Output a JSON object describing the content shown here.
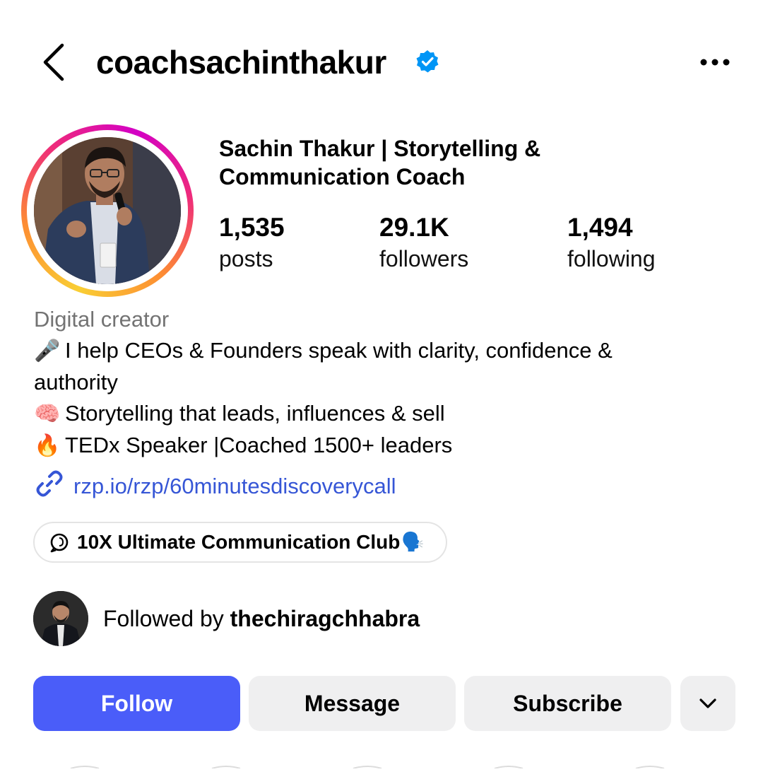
{
  "header": {
    "username": "coachsachinthakur",
    "verified": true,
    "back_icon": "chevron-left-icon",
    "more_icon": "more-horizontal-icon"
  },
  "profile": {
    "display_name": "Sachin Thakur | Storytelling & Communication Coach",
    "stats": [
      {
        "value": "1,535",
        "label": "posts"
      },
      {
        "value": "29.1K",
        "label": "followers"
      },
      {
        "value": "1,494",
        "label": "following"
      }
    ],
    "category": "Digital creator",
    "bio_lines": [
      {
        "emoji": "🎤",
        "text": "I help CEOs & Founders speak with clarity, confidence &"
      },
      {
        "emoji": "",
        "text": "authority"
      },
      {
        "emoji": "🧠",
        "text": "Storytelling that leads, influences & sell"
      },
      {
        "emoji": "🔥",
        "text": "TEDx Speaker |Coached 1500+ leaders"
      }
    ],
    "link": "rzp.io/rzp/60minutesdiscoverycall",
    "thread_chip": "10X Ultimate Communication Club",
    "thread_chip_emoji": "🗣️",
    "followed_by_prefix": "Followed by ",
    "followed_by_user": "thechiragchhabra"
  },
  "actions": {
    "follow": "Follow",
    "message": "Message",
    "subscribe": "Subscribe",
    "more_icon": "chevron-down-icon"
  },
  "colors": {
    "follow_button": "#4a5df9",
    "secondary_button": "#efeff0",
    "link": "#3656d6",
    "verified_badge": "#0095f6",
    "muted_text": "#737373"
  }
}
